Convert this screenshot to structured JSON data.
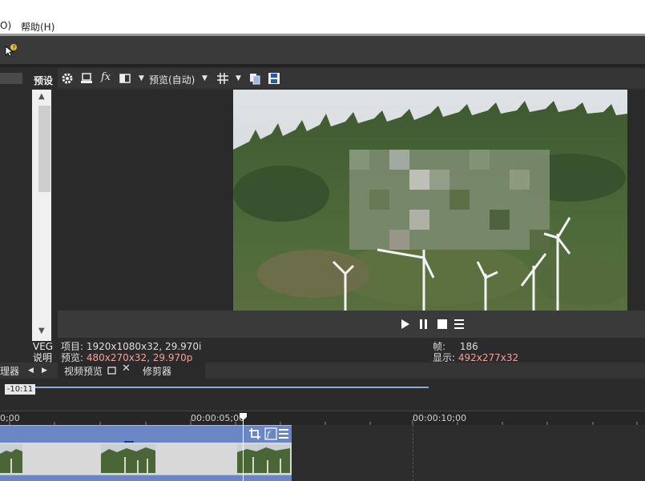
{
  "menubar": {
    "items": [
      "O)",
      "帮助(H)"
    ]
  },
  "left_panel": {
    "preset_label": "预设",
    "veg_label": "VEG",
    "desc_label": "说明",
    "manager_label": "理器"
  },
  "preview_toolbar": {
    "preview_mode": "预览(自动)"
  },
  "info": {
    "project_label": "项目:",
    "project_value": "1920x1080x32, 29.970i",
    "preview_label": "预览:",
    "preview_value": "480x270x32, 29.970p",
    "frame_label": "帧:",
    "frame_value": "186",
    "display_label": "显示:",
    "display_value": "492x277x32"
  },
  "tabs": {
    "video_preview": "视频预览",
    "trimmer": "修剪器"
  },
  "timeline": {
    "cursor_label": "-10:11",
    "ruler_labels": [
      "0;00",
      "00:00:05;00",
      "00:00:10;00"
    ]
  },
  "colors": {
    "accent_pink": "#f0a0a0",
    "track_blue": "#6a86c4",
    "track_select": "#b7cc44"
  }
}
